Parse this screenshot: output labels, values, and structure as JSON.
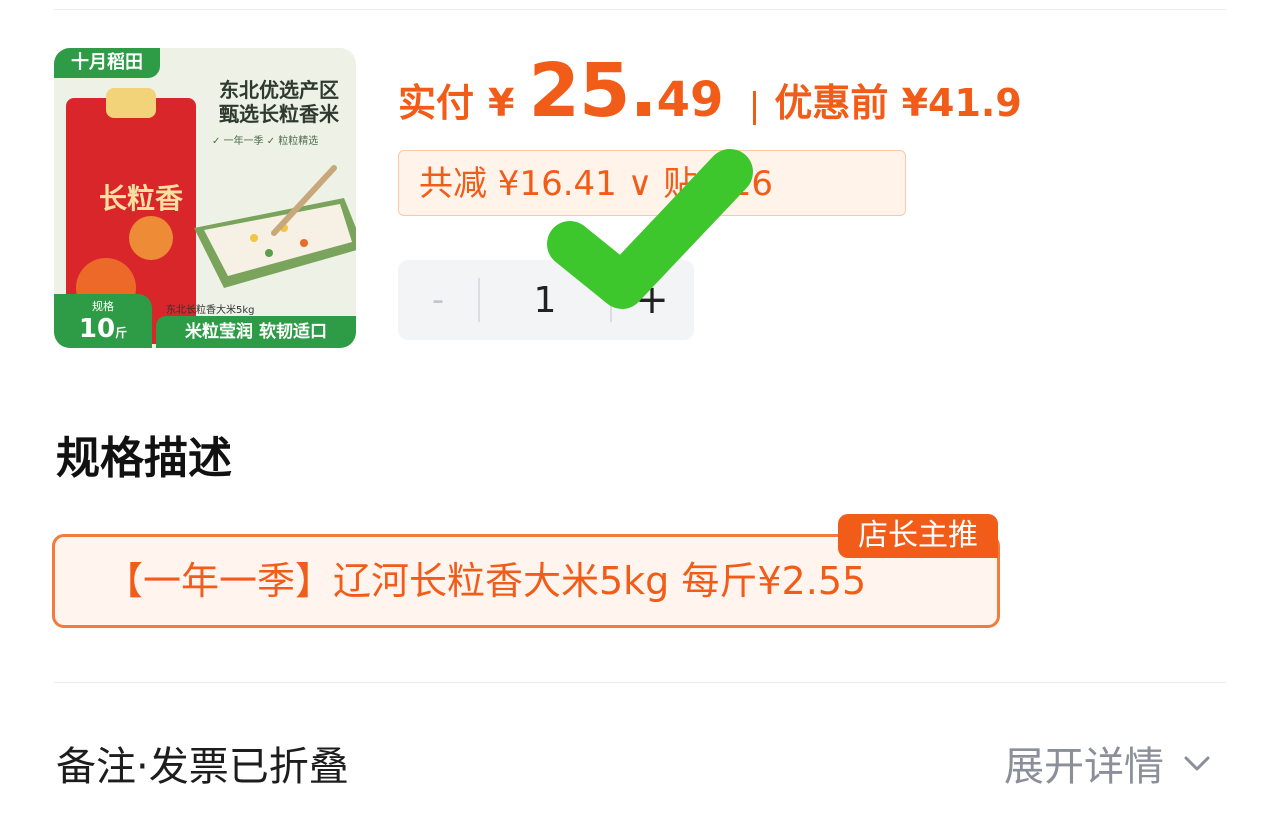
{
  "product": {
    "brand": "十月稻田",
    "headline_line1": "东北优选产区",
    "headline_line2": "甄选长粒香米",
    "features": "✓ 一年一季   ✓ 粒粒精选",
    "bag_text": "长粒香",
    "small_caption": "东北长粒香大米5kg",
    "spec_badge_label": "规格",
    "spec_badge_value": "10",
    "spec_badge_unit": "斤",
    "slogan": "米粒莹润 软韧适口"
  },
  "price": {
    "pay_label": "实付",
    "yen": "¥",
    "amount_int": "25.",
    "amount_dec": "49",
    "original": "优惠前 ¥41.9"
  },
  "discount": {
    "text": "共减 ¥16.41 ∨    贴 ¥16"
  },
  "stepper": {
    "minus": "-",
    "quantity": "1",
    "plus": "+"
  },
  "spec_section": {
    "title": "规格描述",
    "option_text": "【一年一季】辽河长粒香大米5kg  每斤¥2.55",
    "badge": "店长主推"
  },
  "remark": {
    "label": "备注·发票已折叠",
    "expand_label": "展开详情"
  },
  "colors": {
    "accent": "#f25c19",
    "brand_green": "#2e9b46",
    "check_green": "#3ec72c"
  }
}
